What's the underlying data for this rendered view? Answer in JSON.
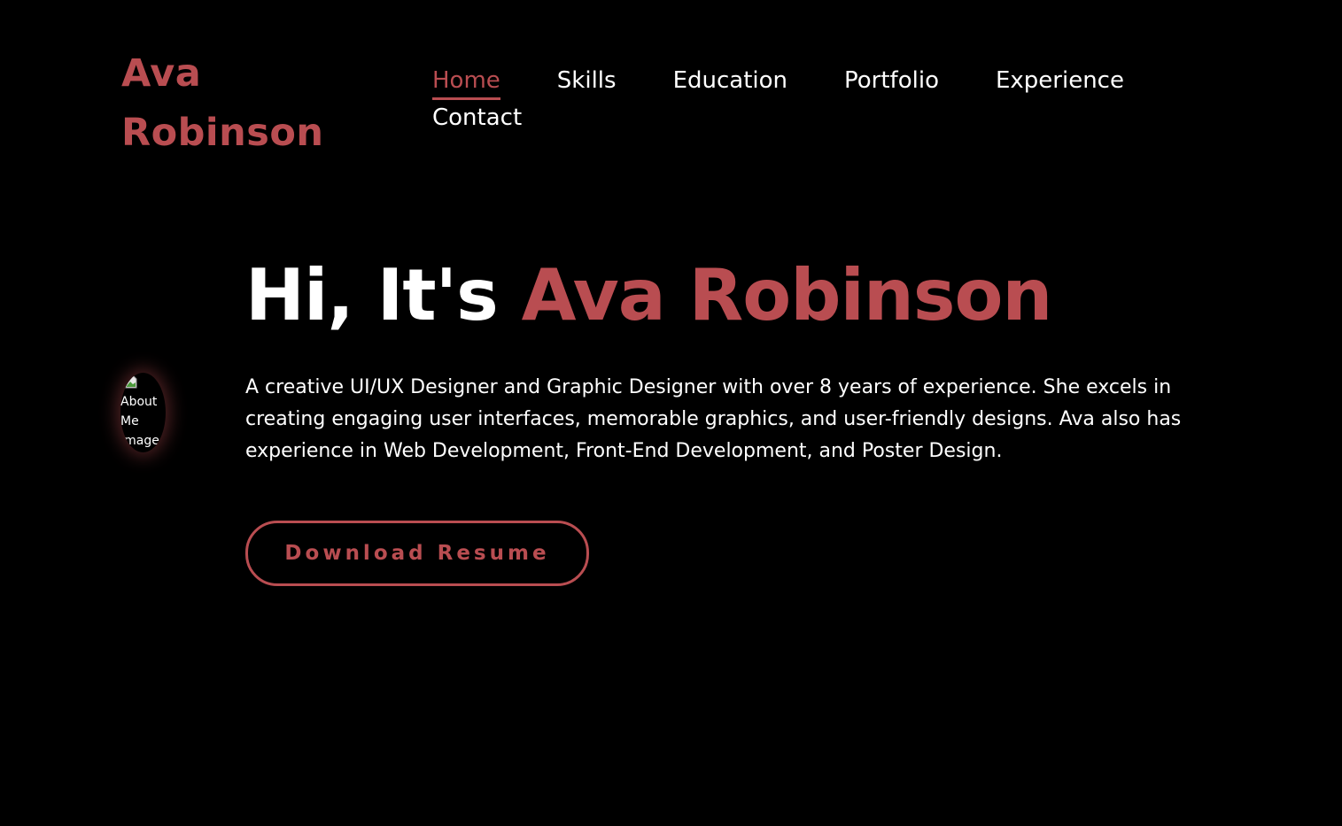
{
  "header": {
    "logo_line1": "Ava",
    "logo_line2": "Robinson",
    "nav": [
      {
        "label": "Home",
        "active": true
      },
      {
        "label": "Skills",
        "active": false
      },
      {
        "label": "Education",
        "active": false
      },
      {
        "label": "Portfolio",
        "active": false
      },
      {
        "label": "Experience",
        "active": false
      },
      {
        "label": "Contact",
        "active": false
      }
    ]
  },
  "hero": {
    "greeting": "Hi, It's",
    "name": "Ava Robinson",
    "description": "A creative UI/UX Designer and Graphic Designer with over 8 years of experience. She excels in creating engaging user interfaces, memorable graphics, and user-friendly designs. Ava also has experience in Web Development, Front-End Development, and Poster Design.",
    "avatar_alt": "About Me Image",
    "button_label": "Download Resume"
  },
  "colors": {
    "background": "#000000",
    "accent": "#b94d51",
    "text": "#ffffff"
  }
}
